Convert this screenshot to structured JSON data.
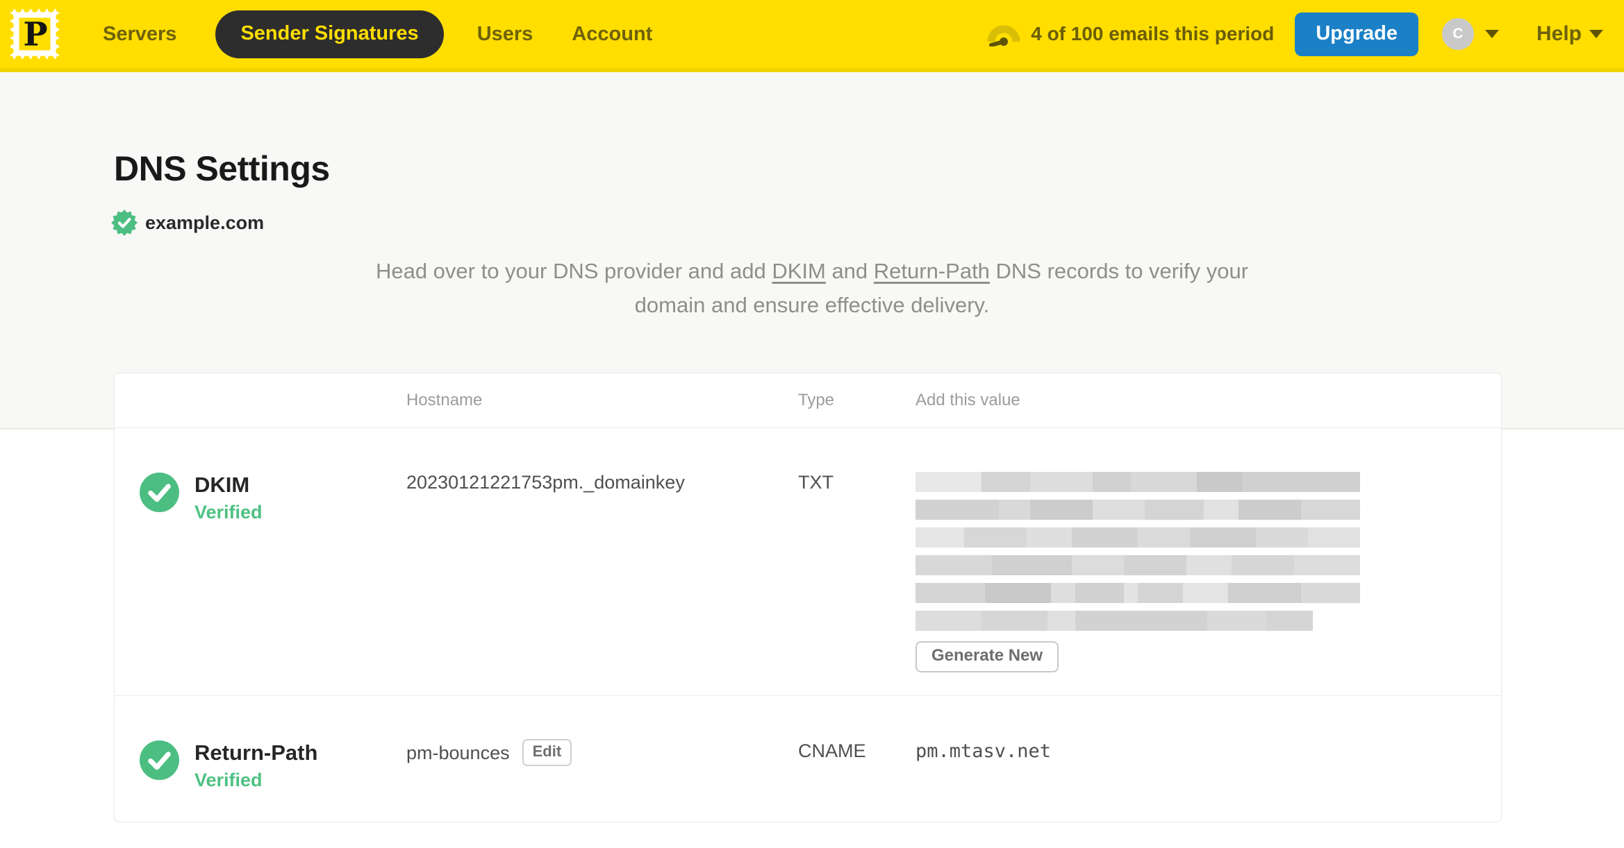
{
  "colors": {
    "brand_yellow": "#FFDE00",
    "nav_active_bg": "#2D2D2D",
    "upgrade_blue": "#1B80C6",
    "verified_green": "#4CBE82",
    "muted_text": "#8E8E8C"
  },
  "nav": {
    "logo_letter": "P",
    "items": [
      {
        "label": "Servers"
      },
      {
        "label": "Sender Signatures",
        "active": true
      },
      {
        "label": "Users"
      },
      {
        "label": "Account"
      }
    ],
    "usage_text": "4 of 100 emails this period",
    "upgrade_label": "Upgrade",
    "avatar_initial": "C",
    "help_label": "Help"
  },
  "header": {
    "title": "DNS Settings",
    "domain": "example.com",
    "instructions": {
      "part1": "Head over to your DNS provider and add ",
      "dkim_link": "DKIM",
      "part2": " and ",
      "return_path_link": "Return-Path",
      "part3": " DNS records to verify your domain and ensure effective delivery."
    }
  },
  "table": {
    "headers": {
      "hostname": "Hostname",
      "type": "Type",
      "value": "Add this value"
    },
    "rows": [
      {
        "name": "DKIM",
        "status": "Verified",
        "hostname": "20230121221753pm._domainkey",
        "type": "TXT",
        "action_label": "Generate New"
      },
      {
        "name": "Return-Path",
        "status": "Verified",
        "hostname": "pm-bounces",
        "edit_label": "Edit",
        "type": "CNAME",
        "value": "pm.mtasv.net"
      }
    ]
  }
}
